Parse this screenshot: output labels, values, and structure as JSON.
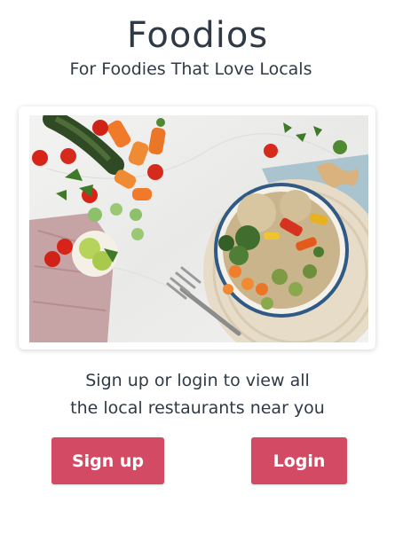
{
  "app": {
    "title": "Foodios",
    "tagline": "For Foodies That Love Locals"
  },
  "hero": {
    "image_icon": "food-bowl-photo"
  },
  "prompt": {
    "line1": "Sign up or login to view all",
    "line2": "the local restaurants near you"
  },
  "actions": {
    "signup_label": "Sign up",
    "login_label": "Login"
  },
  "colors": {
    "accent": "#d24a64",
    "text": "#2f3a46",
    "background": "#ffffff"
  }
}
